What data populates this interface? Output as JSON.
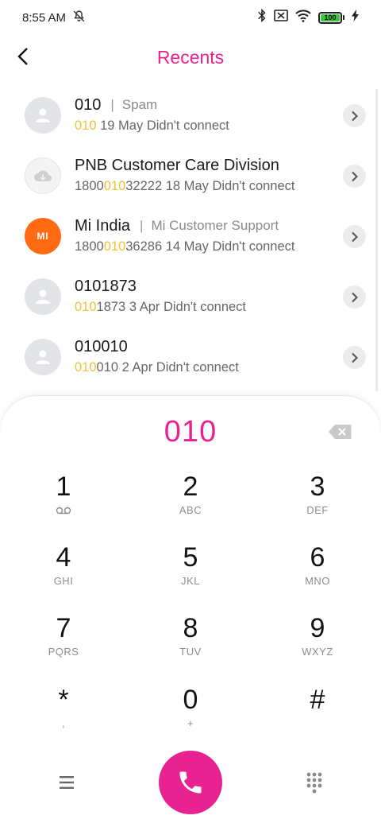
{
  "status_bar": {
    "time": "8:55 AM",
    "battery_level": "100",
    "battery_color": "#3cc43c",
    "icons": [
      "dnd-off-icon",
      "bluetooth-icon",
      "no-sim-icon",
      "wifi-icon",
      "battery-icon",
      "charging-icon"
    ]
  },
  "header": {
    "title": "Recents",
    "back_icon": "chevron-left-icon",
    "title_color": "#e8228f"
  },
  "recents": [
    {
      "name": "010",
      "tag": "Spam",
      "number_highlight": "010",
      "number_rest": "",
      "date": "19 May",
      "status": "Didn't connect",
      "avatar": "person-icon"
    },
    {
      "name": "PNB Customer Care Division",
      "tag": "",
      "number_prefix": "1800",
      "number_highlight": "010",
      "number_rest": "32222",
      "date": "18 May",
      "status": "Didn't connect",
      "avatar": "cloud-icon"
    },
    {
      "name": "Mi India",
      "tag": "Mi Customer Support",
      "number_prefix": "1800",
      "number_highlight": "010",
      "number_rest": "36286",
      "date": "14 May",
      "status": "Didn't connect",
      "avatar_text": "MI",
      "avatar_color": "#ff6a13"
    },
    {
      "name": "0101873",
      "tag": "",
      "number_highlight": "010",
      "number_rest": "1873",
      "date": "3 Apr",
      "status": "Didn't connect",
      "avatar": "person-icon"
    },
    {
      "name": "010010",
      "tag": "",
      "number_highlight": "010",
      "number_rest": "010",
      "date": "2 Apr",
      "status": "Didn't connect",
      "avatar": "person-icon"
    }
  ],
  "dialer": {
    "number": "010",
    "keys": [
      {
        "digit": "1",
        "letters": ""
      },
      {
        "digit": "2",
        "letters": "ABC"
      },
      {
        "digit": "3",
        "letters": "DEF"
      },
      {
        "digit": "4",
        "letters": "GHI"
      },
      {
        "digit": "5",
        "letters": "JKL"
      },
      {
        "digit": "6",
        "letters": "MNO"
      },
      {
        "digit": "7",
        "letters": "PQRS"
      },
      {
        "digit": "8",
        "letters": "TUV"
      },
      {
        "digit": "9",
        "letters": "WXYZ"
      },
      {
        "digit": "*",
        "letters": ","
      },
      {
        "digit": "0",
        "letters": "+"
      },
      {
        "digit": "#",
        "letters": ""
      }
    ],
    "accent": "#e8228f",
    "highlight_color": "#f1c232"
  }
}
